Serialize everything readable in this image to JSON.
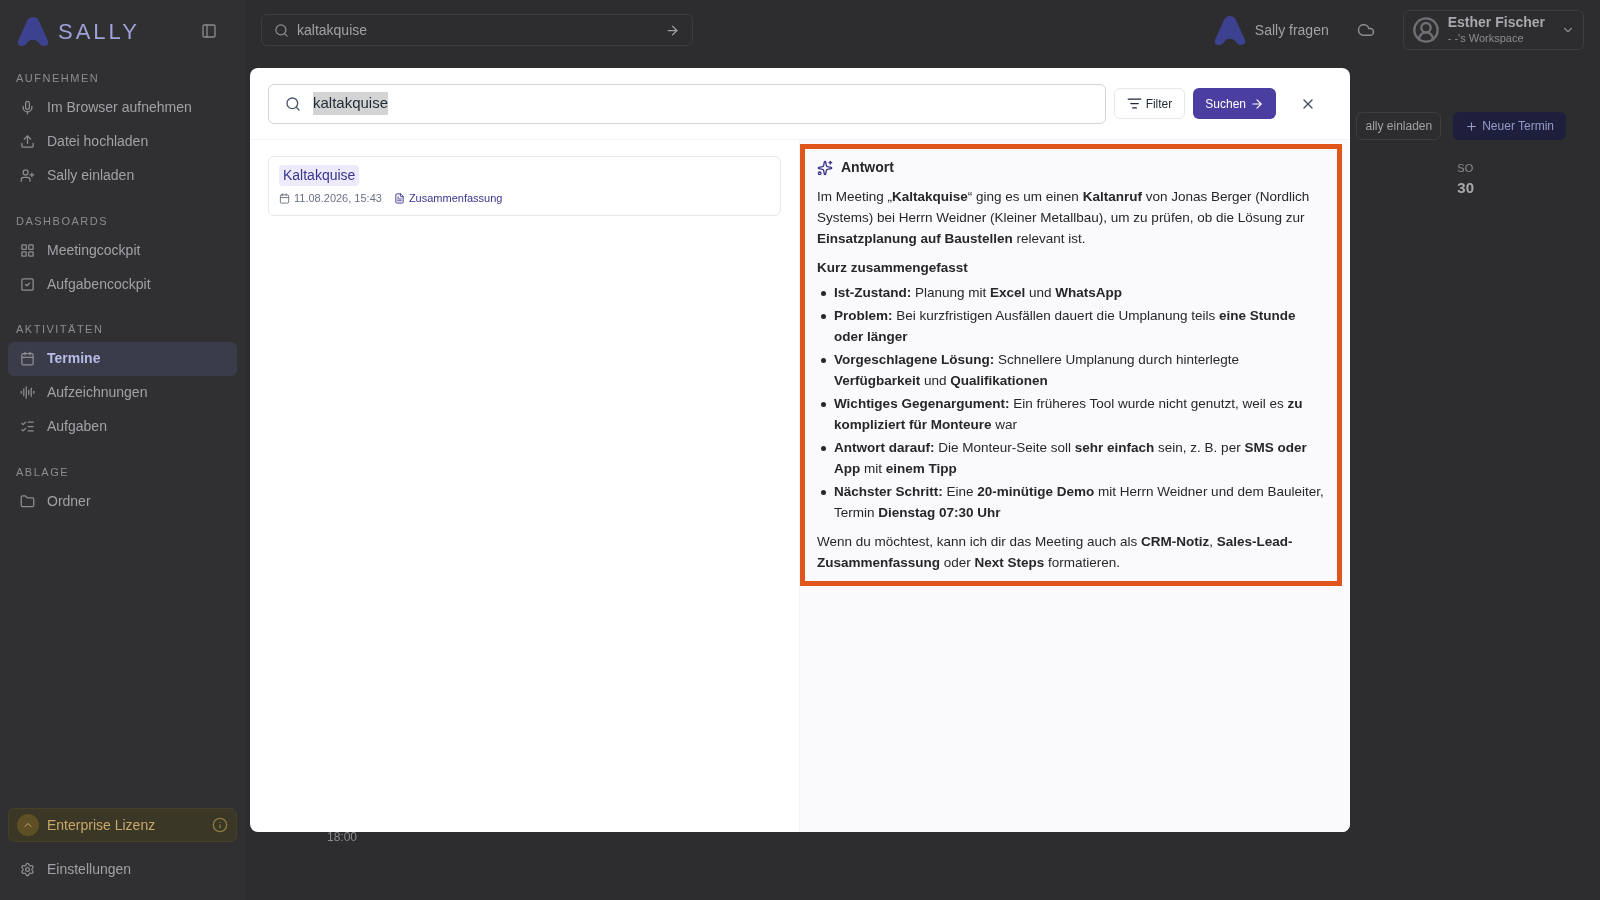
{
  "sidebar": {
    "logo": "SALLY",
    "sections": [
      {
        "title": "AUFNEHMEN",
        "items": [
          {
            "label": "Im Browser aufnehmen",
            "selected": false
          },
          {
            "label": "Datei hochladen",
            "selected": false
          },
          {
            "label": "Sally einladen",
            "selected": false
          }
        ]
      },
      {
        "title": "DASHBOARDS",
        "items": [
          {
            "label": "Meetingcockpit",
            "selected": false
          },
          {
            "label": "Aufgabencockpit",
            "selected": false
          }
        ]
      },
      {
        "title": "AKTIVITÄTEN",
        "items": [
          {
            "label": "Termine",
            "selected": true
          },
          {
            "label": "Aufzeichnungen",
            "selected": false
          },
          {
            "label": "Aufgaben",
            "selected": false
          }
        ]
      },
      {
        "title": "ABLAGE",
        "items": [
          {
            "label": "Ordner",
            "selected": false
          }
        ]
      }
    ],
    "license": "Enterprise Lizenz",
    "settings": "Einstellungen"
  },
  "topbar": {
    "search": "kaltakquise",
    "ask": "Sally fragen",
    "user_name": "Esther Fischer",
    "workspace": "- -'s Workspace"
  },
  "background": {
    "invite": "ally einladen",
    "new_event": "Neuer Termin",
    "weekday": "SO",
    "date": "30",
    "time": "18:00"
  },
  "modal": {
    "search": "kaltakquise",
    "text_selected": true,
    "filter": "Filter",
    "submit": "Suchen",
    "results": [
      {
        "title": "Kaltakquise",
        "date": "11.08.2026, 15:43",
        "tag": "Zusammenfassung"
      }
    ],
    "answer": {
      "highlighted": true,
      "title": "Antwort",
      "intro": "Im Meeting „**Kaltakquise**“ ging es um einen **Kaltanruf** von Jonas Berger (Nordlich Systems) bei Herrn Weidner (Kleiner Metallbau), um zu prüfen, ob die Lösung zur **Einsatzplanung auf Baustellen** relevant ist.",
      "heading": "Kurz zusammengefasst",
      "bullets": [
        "**Ist-Zustand:** Planung mit **Excel** und **WhatsApp**",
        "**Problem:** Bei kurzfristigen Ausfällen dauert die Umplanung teils **eine Stunde oder länger**",
        "**Vorgeschlagene Lösung:** Schnellere Umplanung durch hinterlegte **Verfügbarkeit** und **Qualifikationen**",
        "**Wichtiges Gegenargument:** Ein früheres Tool wurde nicht genutzt, weil es **zu kompliziert für Monteure** war",
        "**Antwort darauf:** Die Monteur-Seite soll **sehr einfach** sein, z. B. per **SMS oder App** mit **einem Tipp**",
        "**Nächster Schritt:** Eine **20-minütige Demo** mit Herrn Weidner und dem Bauleiter, Termin **Dienstag 07:30 Uhr**"
      ],
      "outro": "Wenn du möchtest, kann ich dir das Meeting auch als **CRM-Notiz**, **Sales-Lead-Zusammenfassung** oder **Next Steps** formatieren."
    }
  }
}
